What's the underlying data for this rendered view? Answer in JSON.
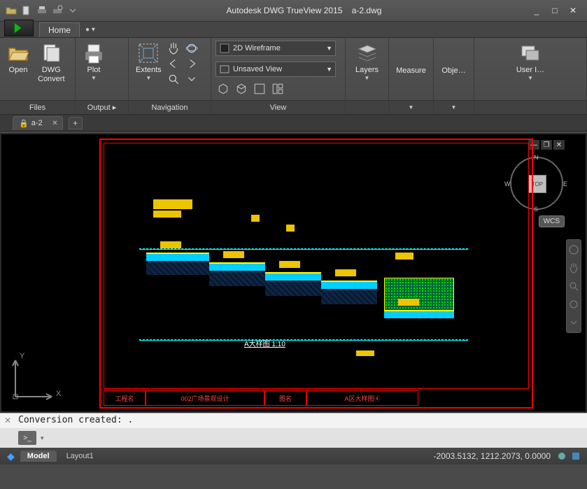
{
  "titlebar": {
    "app_title": "Autodesk DWG TrueView 2015",
    "filename": "a-2.dwg",
    "qat_icons": [
      "open-icon",
      "new-icon",
      "plot-icon",
      "plot-preview-icon",
      "undo-icon"
    ]
  },
  "window_controls": {
    "minimize": "_",
    "maximize": "□",
    "close": "✕"
  },
  "tabs": {
    "home": "Home",
    "bullet": "● ▾"
  },
  "ribbon": {
    "files": {
      "title": "Files",
      "open": "Open",
      "dwg_convert": "DWG\nConvert"
    },
    "output": {
      "title": "Output  ▸",
      "plot": "Plot"
    },
    "navigation": {
      "title": "Navigation",
      "extents": "Extents"
    },
    "view": {
      "title": "View",
      "visual_style": "2D Wireframe",
      "named_view": "Unsaved View"
    },
    "layers": {
      "title": "",
      "label": "Layers"
    },
    "measure": "Measure",
    "object": "Obje…",
    "user": "User I…"
  },
  "doc_tabs": {
    "current": "a-2",
    "add": "+"
  },
  "viewport": {
    "controls": {
      "min": "—",
      "restore": "❐",
      "close": "✕"
    },
    "cube_top": "TOP",
    "dirs": {
      "n": "N",
      "e": "E",
      "s": "S",
      "w": "W"
    },
    "wcs": "WCS",
    "ucs": {
      "x": "X",
      "y": "Y"
    }
  },
  "drawing": {
    "tb1": "工程名",
    "tb2": "002广场景观设计",
    "tb3": "图名",
    "tb4": "A区大样图④",
    "scale_caption": "A大样图  1:10"
  },
  "command": {
    "output": "Conversion created: .",
    "prompt": ">_"
  },
  "layouts": {
    "model": "Model",
    "layout1": "Layout1"
  },
  "status": {
    "coords": "-2003.5132, 1212.2073, 0.0000"
  }
}
